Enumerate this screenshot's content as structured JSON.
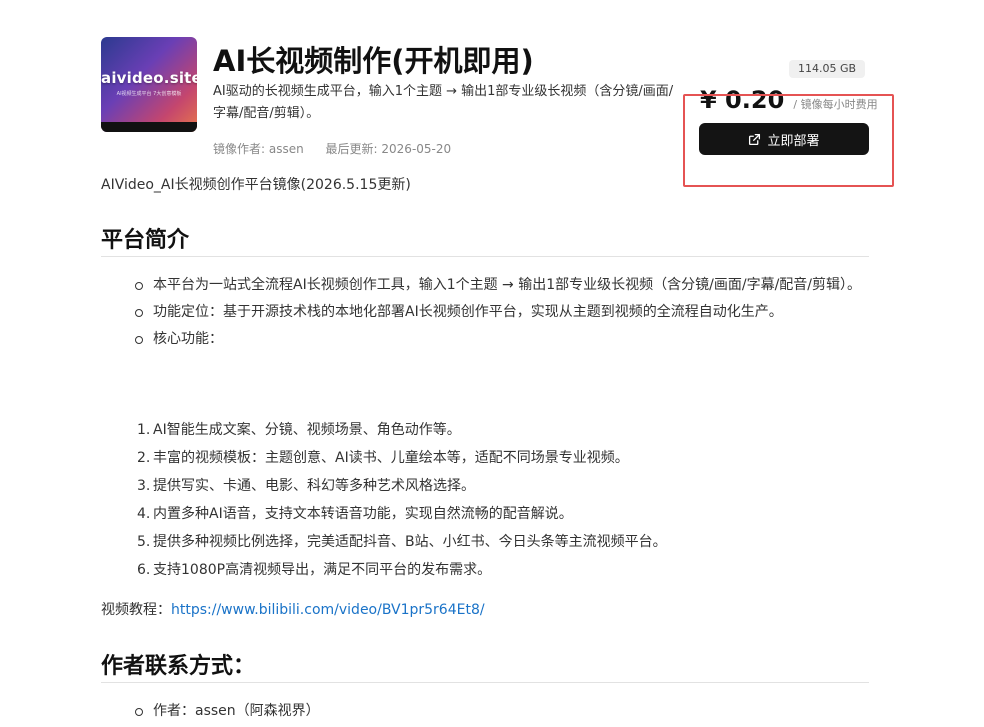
{
  "product": {
    "thumbnail_text": "aivideo.site",
    "thumbnail_subtext": "AI视频生成平台 7大创意模板",
    "title": "AI长视频制作(开机即用)",
    "description": "AI驱动的长视频生成平台，输入1个主题 → 输出1部专业级长视频（含分镜/画面/字幕/配音/剪辑）。",
    "author_label": "镜像作者: assen",
    "updated_label": "最后更新: 2026-05-20",
    "size": "114.05 GB",
    "price": "¥ 0.20",
    "price_unit": "/ 镜像每小时费用",
    "deploy_label": "立即部署"
  },
  "subtitle": "AIVideo_AI长视频创作平台镜像(2026.5.15更新)",
  "section_intro": {
    "heading": "平台简介",
    "bullets": [
      "本平台为一站式全流程AI长视频创作工具，输入1个主题 → 输出1部专业级长视频（含分镜/画面/字幕/配音/剪辑）。",
      "功能定位：基于开源技术栈的本地化部署AI长视频创作平台，实现从主题到视频的全流程自动化生产。",
      "核心功能："
    ],
    "features": [
      "AI智能生成文案、分镜、视频场景、角色动作等。",
      "丰富的视频模板：主题创意、AI读书、儿童绘本等，适配不同场景专业视频。",
      "提供写实、卡通、电影、科幻等多种艺术风格选择。",
      "内置多种AI语音，支持文本转语音功能，实现自然流畅的配音解说。",
      "提供多种视频比例选择，完美适配抖音、B站、小红书、今日头条等主流视频平台。",
      "支持1080P高清视频导出，满足不同平台的发布需求。"
    ],
    "tutorial_label": "视频教程：",
    "tutorial_link": "https://www.bilibili.com/video/BV1pr5r64Et8/"
  },
  "section_contact": {
    "heading": "作者联系方式：",
    "bullets": [
      "作者：assen（阿森视界）"
    ]
  }
}
